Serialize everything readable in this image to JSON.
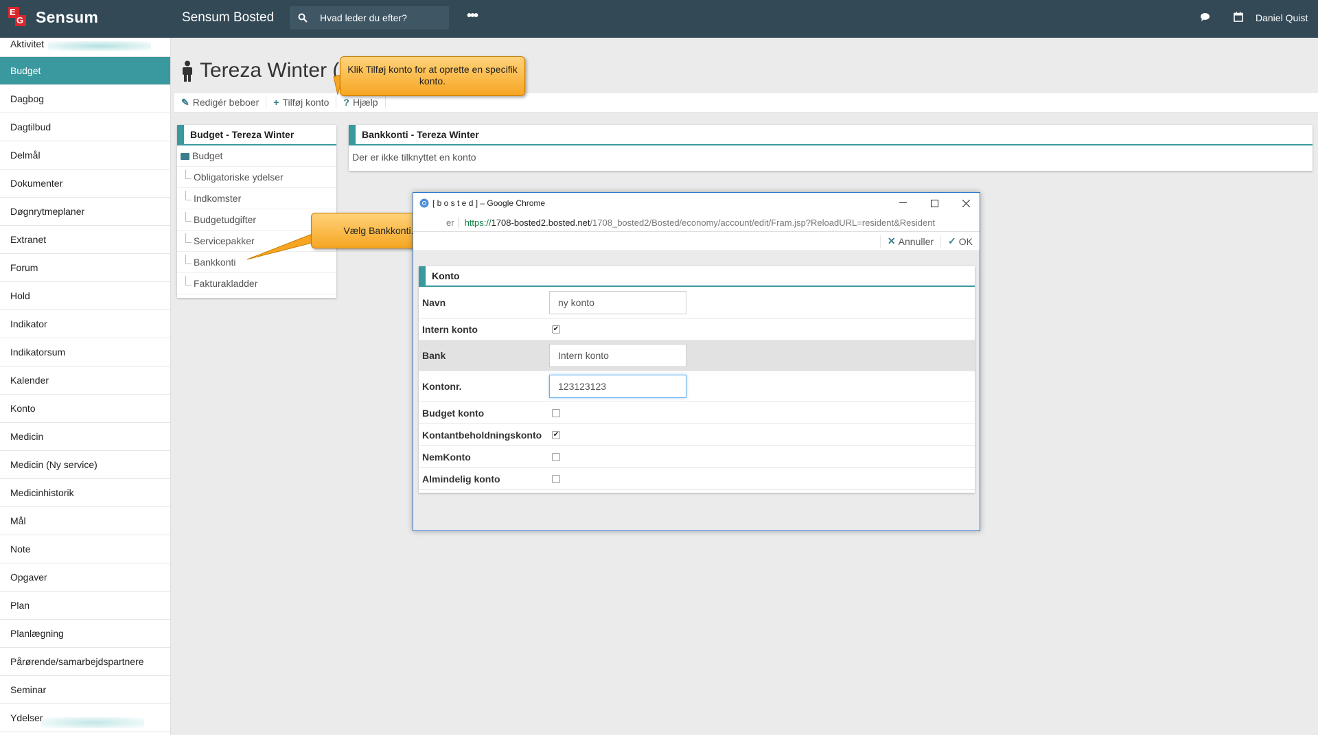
{
  "topbar": {
    "logo_text": "Sensum",
    "logo_letters": [
      "E",
      "G"
    ],
    "app_title": "Sensum Bosted",
    "search_placeholder": "Hvad leder du efter?",
    "more_label": "•••",
    "user_name": "Daniel Quist",
    "bg_color": "#334956"
  },
  "sidebar": {
    "accent_color": "#3a999e",
    "items": [
      {
        "label": "Aktivitet",
        "active": false
      },
      {
        "label": "Budget",
        "active": true
      },
      {
        "label": "Dagbog",
        "active": false
      },
      {
        "label": "Dagtilbud",
        "active": false
      },
      {
        "label": "Delmål",
        "active": false
      },
      {
        "label": "Dokumenter",
        "active": false
      },
      {
        "label": "Døgnrytmeplaner",
        "active": false
      },
      {
        "label": "Extranet",
        "active": false
      },
      {
        "label": "Forum",
        "active": false
      },
      {
        "label": "Hold",
        "active": false
      },
      {
        "label": "Indikator",
        "active": false
      },
      {
        "label": "Indikatorsum",
        "active": false
      },
      {
        "label": "Kalender",
        "active": false
      },
      {
        "label": "Konto",
        "active": false
      },
      {
        "label": "Medicin",
        "active": false
      },
      {
        "label": "Medicin (Ny service)",
        "active": false
      },
      {
        "label": "Medicinhistorik",
        "active": false
      },
      {
        "label": "Mål",
        "active": false
      },
      {
        "label": "Note",
        "active": false
      },
      {
        "label": "Opgaver",
        "active": false
      },
      {
        "label": "Plan",
        "active": false
      },
      {
        "label": "Planlægning",
        "active": false
      },
      {
        "label": "Pårørende/samarbejdspartnere",
        "active": false
      },
      {
        "label": "Seminar",
        "active": false
      },
      {
        "label": "Ydelser",
        "active": false
      }
    ]
  },
  "page": {
    "title": "Tereza Winter (",
    "toolbar": {
      "edit_label": "Redigér beboer",
      "add_account_label": "Tilføj konto",
      "help_label": "Hjælp"
    }
  },
  "budget_panel": {
    "title": "Budget - Tereza Winter",
    "root": "Budget",
    "items": [
      "Obligatoriske ydelser",
      "Indkomster",
      "Budgetudgifter",
      "Servicepakker",
      "Bankkonti",
      "Fakturakladder"
    ]
  },
  "bank_panel": {
    "title": "Bankkonti - Tereza Winter",
    "empty_text": "Der er ikke tilknyttet en konto"
  },
  "callouts": {
    "add_account_hint": "Klik Tilføj konto for at oprette en specifik konto.",
    "choose_bank_hint": "Vælg Bankkonti.",
    "color": "#f6a623"
  },
  "dialog": {
    "window_title": "[ b o s t e d ] – Google Chrome",
    "security_label": "er",
    "url_scheme": "https://",
    "url_host": "1708-bosted2.bosted.net",
    "url_path": "/1708_bosted2/Bosted/economy/account/edit/Fram.jsp?ReloadURL=resident&Resident",
    "cancel_label": "Annuller",
    "ok_label": "OK",
    "panel_title": "Konto",
    "fields": {
      "navn_label": "Navn",
      "navn_value": "ny konto",
      "intern_label": "Intern konto",
      "intern_checked": true,
      "bank_label": "Bank",
      "bank_value": "Intern konto",
      "kontonr_label": "Kontonr.",
      "kontonr_value": "123123123",
      "budget_label": "Budget konto",
      "budget_checked": false,
      "kontant_label": "Kontantbeholdningskonto",
      "kontant_checked": true,
      "nem_label": "NemKonto",
      "nem_checked": false,
      "almindelig_label": "Almindelig konto",
      "almindelig_checked": false
    }
  }
}
